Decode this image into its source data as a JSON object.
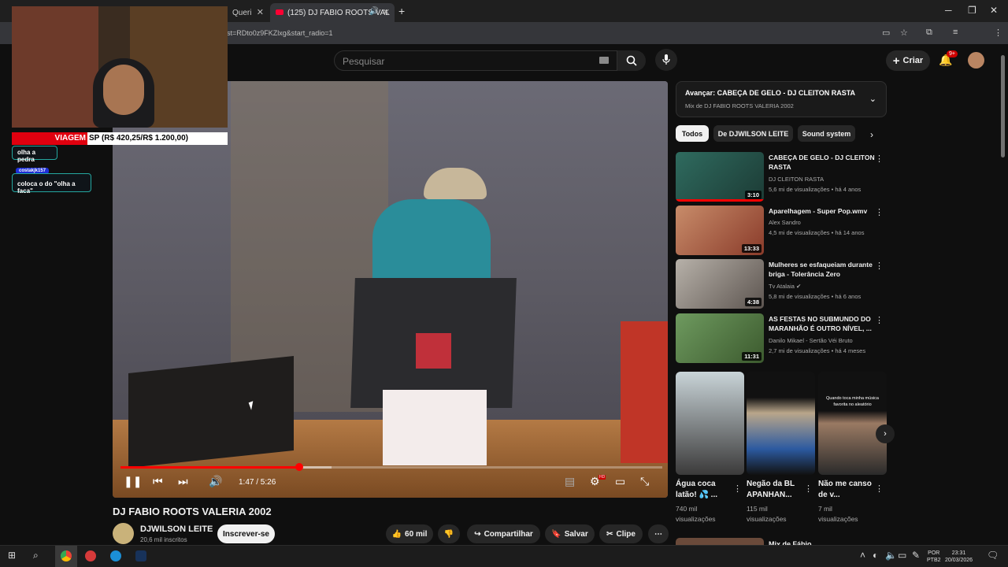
{
  "browser": {
    "tabs": [
      {
        "label": "Queri",
        "active": false
      },
      {
        "label": "(125) DJ FABIO ROOTS VAL",
        "active": true
      }
    ],
    "url": "st=RDto0z9FKZlxg&start_radio=1"
  },
  "youtube_header": {
    "search_placeholder": "Pesquisar",
    "create_label": "Criar",
    "notifications_badge": "9+"
  },
  "webcam_overlay": {
    "ticker_red": "VIAGEM",
    "ticker_text": "SP (R$ 420,25/R$ 1.200,00)",
    "chat": [
      {
        "user": "",
        "message": "olha a pedra"
      },
      {
        "user": "costakjk157",
        "message": "coloca o do \"olha a faca\""
      }
    ]
  },
  "player": {
    "current_time": "1:47",
    "duration": "5:26",
    "time_display": "1:47 / 5:26",
    "progress": 0.33,
    "buffered": 0.39,
    "hd_badge": "HD"
  },
  "video": {
    "title": "DJ FABIO ROOTS VALERIA 2002",
    "channel_name": "DJWILSON LEITE",
    "channel_subs": "20,6 mil inscritos",
    "subscribe_label": "Inscrever-se",
    "likes": "60 mil",
    "share_label": "Compartilhar",
    "save_label": "Salvar",
    "clip_label": "Clipe"
  },
  "sidebar": {
    "up_next_title": "Avançar: CABEÇA DE GELO - DJ CLEITON RASTA",
    "up_next_sub": "Mix de DJ FABIO ROOTS VALERIA 2002",
    "chips": [
      "Todos",
      "De DJWILSON LEITE",
      "Sound system"
    ],
    "recommendations": [
      {
        "title": "CABEÇA DE GELO - DJ CLEITON RASTA",
        "channel": "DJ CLEITON RASTA",
        "meta": "5,6 mi de visualizações • há 4 anos",
        "duration": "3:10"
      },
      {
        "title": "Aparelhagem - Super Pop.wmv",
        "channel": "Alex Sandro",
        "meta": "4,5 mi de visualizações • há 14 anos",
        "duration": "13:33"
      },
      {
        "title": "Mulheres se esfaqueiam durante briga - Tolerância Zero",
        "channel": "Tv Atalaia",
        "meta": "5,8 mi de visualizações • há 6 anos",
        "duration": "4:38"
      },
      {
        "title": "AS FESTAS NO SUBMUNDO DO MARANHÃO É OUTRO NÍVEL, ...",
        "channel": "Danilo Mikael - Sertão Véi Bruto",
        "meta": "2,7 mi de visualizações • há 4 meses",
        "duration": "11:31"
      }
    ],
    "shorts": [
      {
        "title": "Água coca latão! 💦 ...",
        "views": "740 mil visualizações"
      },
      {
        "title": "Negão da BL APANHAN...",
        "views": "115 mil visualizações"
      },
      {
        "title": "Não me canso de v...",
        "views": "7 mil visualizações"
      }
    ],
    "short3_caption": "Quando toca minha música favorita no aleatório",
    "next_partial_title": "Mix de Fábio"
  },
  "taskbar": {
    "lang": "POR",
    "lang2": "PTB2",
    "time": "23:31",
    "date": "20/03/2026"
  }
}
